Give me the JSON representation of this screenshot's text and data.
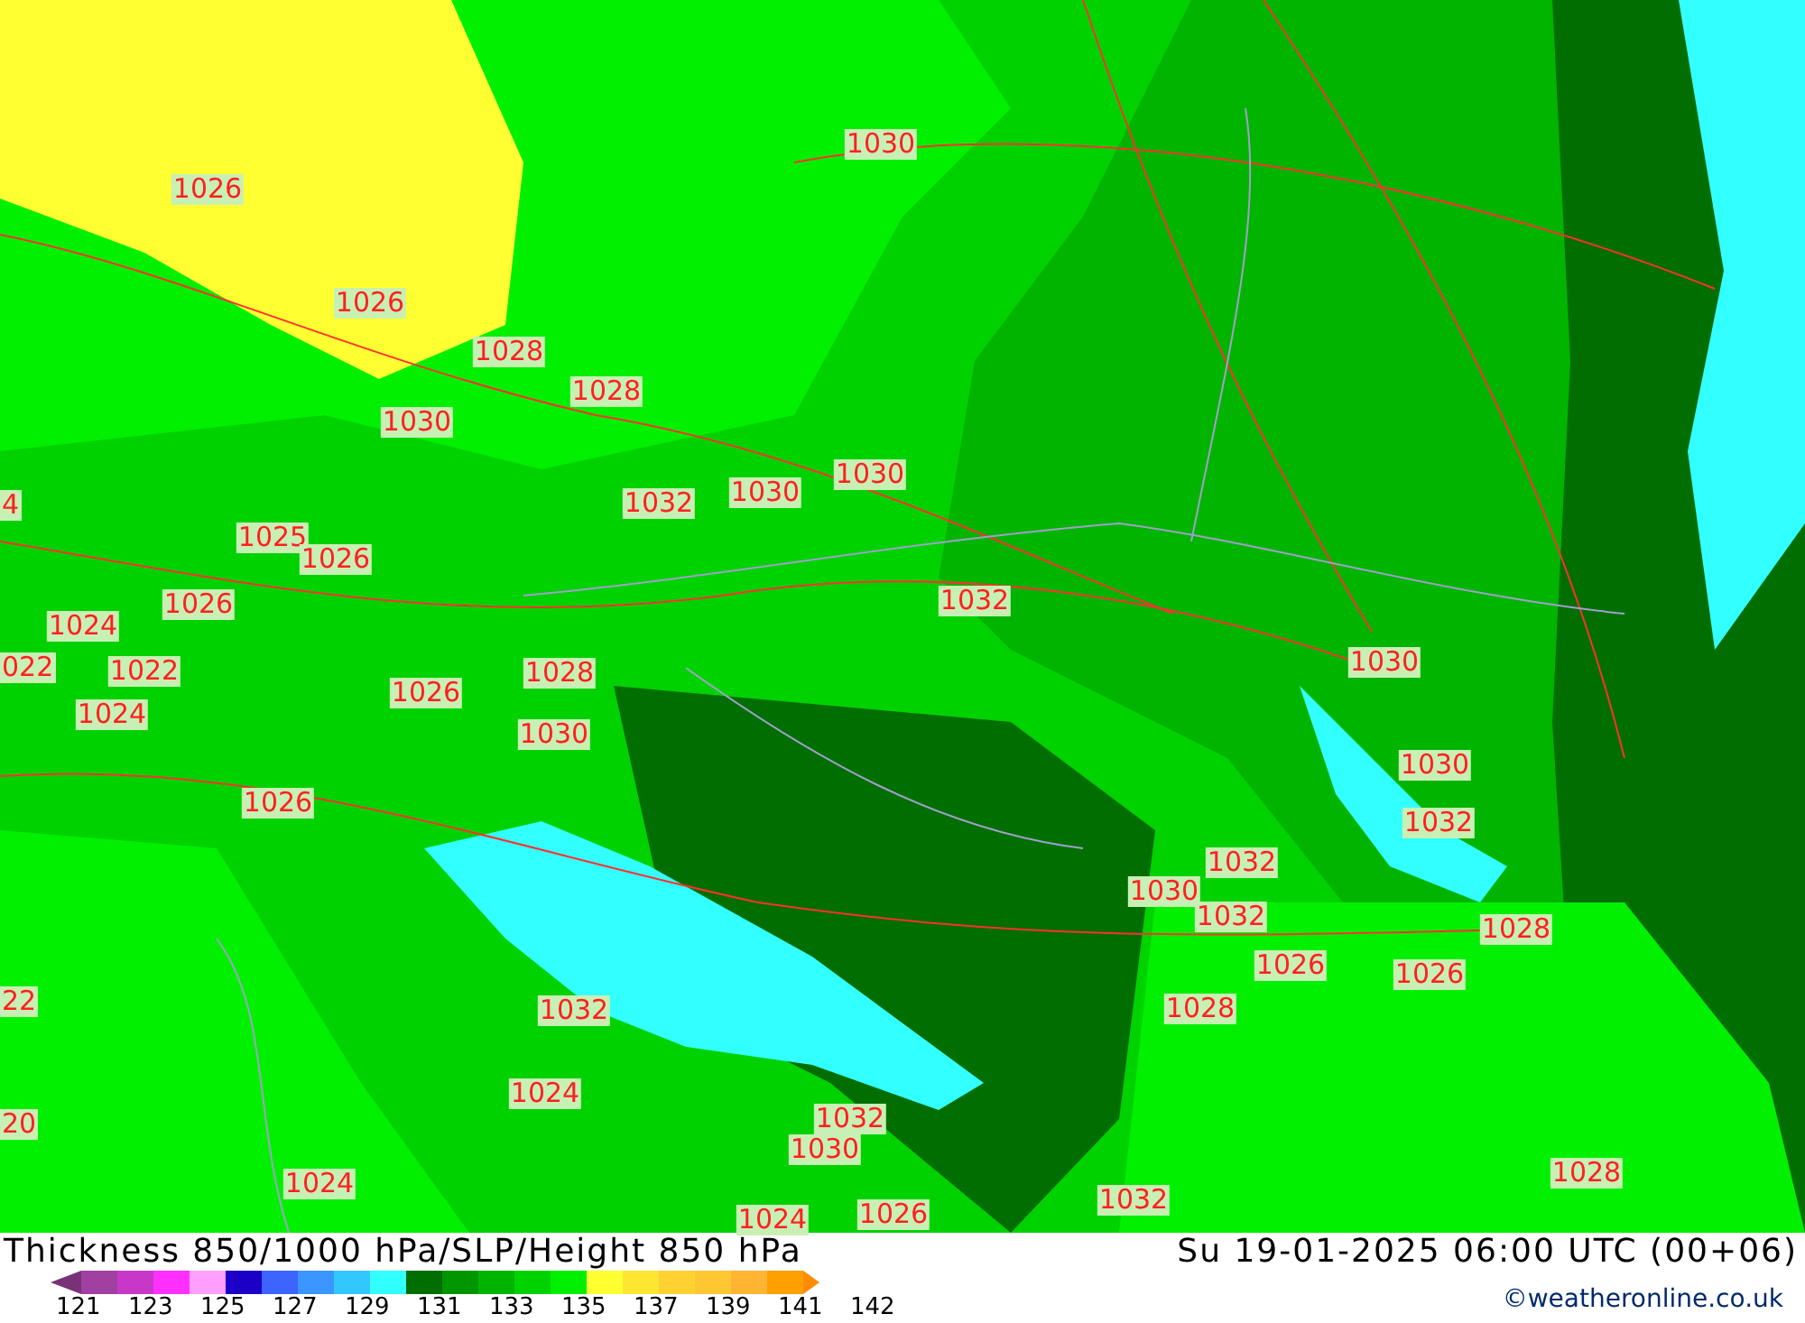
{
  "map": {
    "isobar_labels": [
      {
        "text": "1030"
      },
      {
        "text": "1026"
      },
      {
        "text": "1026"
      },
      {
        "text": "1028"
      },
      {
        "text": "1028"
      },
      {
        "text": "1030"
      },
      {
        "text": "4"
      },
      {
        "text": "1032"
      },
      {
        "text": "1030"
      },
      {
        "text": "1030"
      },
      {
        "text": "1025"
      },
      {
        "text": "1026"
      },
      {
        "text": "1024"
      },
      {
        "text": "1026"
      },
      {
        "text": "1032"
      },
      {
        "text": "022"
      },
      {
        "text": "1022"
      },
      {
        "text": "1026"
      },
      {
        "text": "1028"
      },
      {
        "text": "1030"
      },
      {
        "text": "1024"
      },
      {
        "text": "1030"
      },
      {
        "text": "1030"
      },
      {
        "text": "1026"
      },
      {
        "text": "1032"
      },
      {
        "text": "1032"
      },
      {
        "text": "1030"
      },
      {
        "text": "1032"
      },
      {
        "text": "1028"
      },
      {
        "text": "1026"
      },
      {
        "text": "1026"
      },
      {
        "text": "22"
      },
      {
        "text": "1032"
      },
      {
        "text": "1028"
      },
      {
        "text": "1024"
      },
      {
        "text": "20"
      },
      {
        "text": "1032"
      },
      {
        "text": "1030"
      },
      {
        "text": "1024"
      },
      {
        "text": "1024"
      },
      {
        "text": "1026"
      },
      {
        "text": "1032"
      },
      {
        "text": "1028"
      }
    ]
  },
  "footer": {
    "title": "Thickness 850/1000 hPa/SLP/Height 850 hPa",
    "valid_time": "Su 19-01-2025 06:00 UTC (00+06)",
    "credit": "©weatheronline.co.uk",
    "legend": {
      "segments": [
        {
          "color": "#a040a0"
        },
        {
          "color": "#c838c8"
        },
        {
          "color": "#ff30ff"
        },
        {
          "color": "#ffa0ff"
        },
        {
          "color": "#1c00c8"
        },
        {
          "color": "#3c64ff"
        },
        {
          "color": "#3c96ff"
        },
        {
          "color": "#32c8ff"
        },
        {
          "color": "#32ffff"
        },
        {
          "color": "#006e00"
        },
        {
          "color": "#009600"
        },
        {
          "color": "#00b400"
        },
        {
          "color": "#00d200"
        },
        {
          "color": "#00f000"
        },
        {
          "color": "#ffff32"
        },
        {
          "color": "#ffe632"
        },
        {
          "color": "#ffd232"
        },
        {
          "color": "#ffc832"
        },
        {
          "color": "#ffb432"
        },
        {
          "color": "#ffa000"
        }
      ],
      "ticks": [
        "121",
        "123",
        "125",
        "127",
        "129",
        "131",
        "133",
        "135",
        "137",
        "139",
        "141",
        "142"
      ]
    }
  }
}
